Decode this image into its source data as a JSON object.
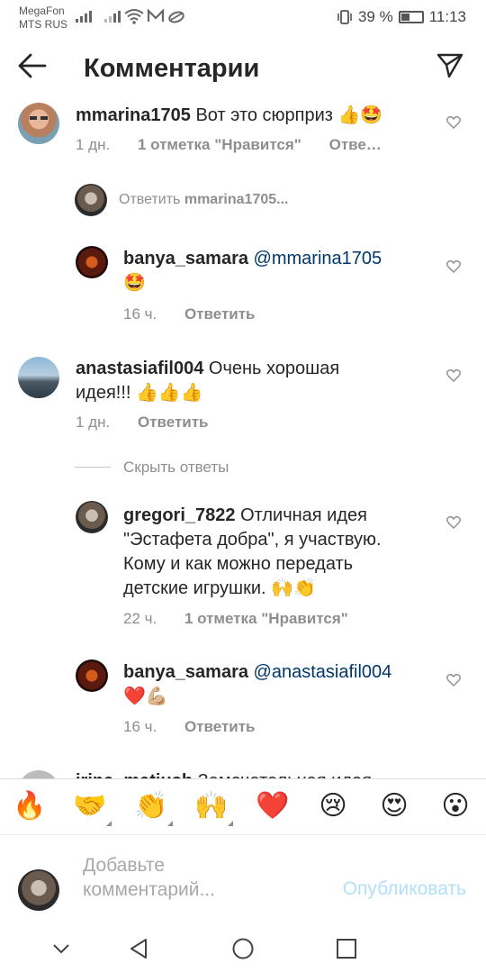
{
  "status_bar": {
    "carrier_1": "MegaFon",
    "carrier_2": "MTS RUS",
    "battery": "39 %",
    "time": "11:13"
  },
  "header": {
    "title": "Комментарии"
  },
  "comments": [
    {
      "username": "mmarina1705",
      "text": "Вот это сюрприз 👍🤩",
      "time": "1 дн.",
      "likes": "1 отметка \"Нравится\"",
      "reply": "Отве…"
    },
    {
      "username": "banya_samara",
      "mention": "@mmarina1705",
      "text": "🤩",
      "time": "16 ч.",
      "reply": "Ответить"
    },
    {
      "username": "anastasiafil004",
      "text": "Очень хорошая",
      "text_2": "идея!!! 👍👍👍",
      "time": "1 дн.",
      "reply": "Ответить"
    },
    {
      "username": "gregori_7822",
      "text": "Отличная идея",
      "text_2": "\"Эстафета добра\", я  участвую.",
      "text_3": "Кому и как можно передать",
      "text_4": "детские игрушки. 🙌👏",
      "time": "22 ч.",
      "likes": "1 отметка \"Нравится\""
    },
    {
      "username": "banya_samara",
      "mention": "@anastasiafil004",
      "text": "❤️💪🏼",
      "time": "16 ч.",
      "reply": "Ответить"
    }
  ],
  "reply_hint": {
    "prefix": "Ответить",
    "username": "mmarina1705..."
  },
  "hide_replies": "Скрыть ответы",
  "partial_comment": {
    "username": "irina_matiush",
    "text": "Замечательная идея"
  },
  "emoji_bar": [
    "🔥",
    "🤝",
    "👏",
    "🙌",
    "❤️",
    "😢",
    "😍",
    "😮"
  ],
  "input": {
    "placeholder_1": "Добавьте",
    "placeholder_2": "комментарий...",
    "publish": "Опубликовать"
  }
}
